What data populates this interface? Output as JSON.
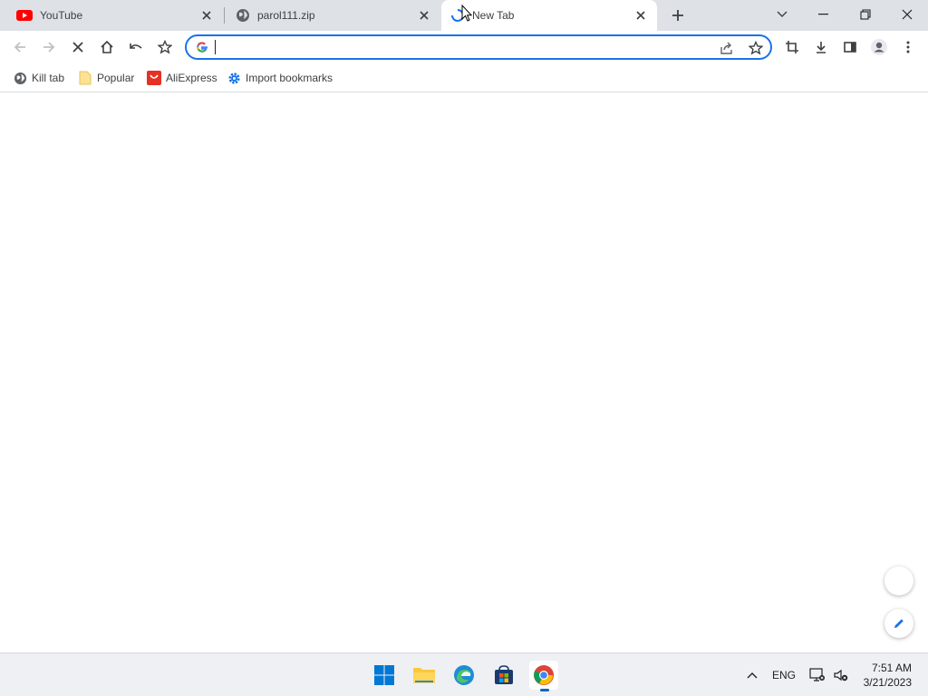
{
  "tabs": [
    {
      "title": "YouTube",
      "icon": "youtube-icon"
    },
    {
      "title": "parol111.zip",
      "icon": "globe-icon"
    },
    {
      "title": "New Tab",
      "icon": "loading-spinner-icon"
    }
  ],
  "toolbar": {
    "omnibox_value": "",
    "omnibox_placeholder": ""
  },
  "bookmarks": [
    {
      "label": "Kill tab",
      "icon": "globe-icon"
    },
    {
      "label": "Popular",
      "icon": "folder-icon"
    },
    {
      "label": "AliExpress",
      "icon": "aliexpress-icon"
    },
    {
      "label": "Import bookmarks",
      "icon": "gear-icon"
    }
  ],
  "taskbar": {
    "apps": [
      "windows-start-icon",
      "file-explorer-icon",
      "edge-icon",
      "store-icon",
      "chrome-icon"
    ],
    "language": "ENG",
    "time": "7:51 AM",
    "date": "3/21/2023"
  },
  "colors": {
    "accent": "#1a73e8",
    "tabstrip": "#dee1e6",
    "youtube_red": "#ff0000"
  }
}
